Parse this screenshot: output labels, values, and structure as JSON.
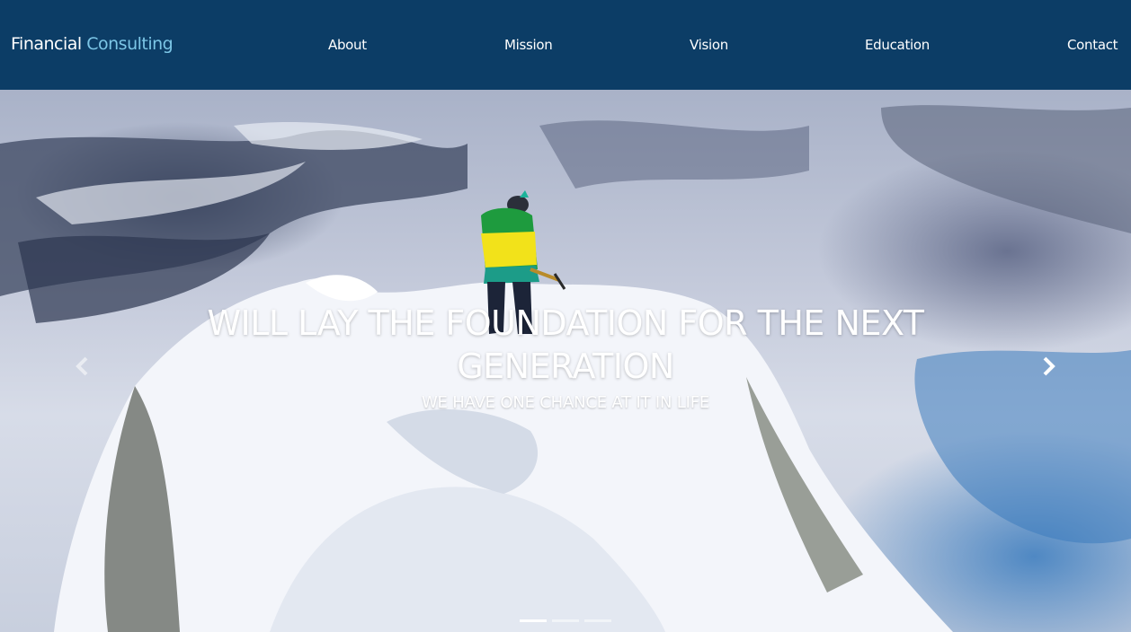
{
  "brand": {
    "name_primary": "Financial",
    "name_accent": "Consulting"
  },
  "nav": {
    "items": [
      {
        "label": "About"
      },
      {
        "label": "Mission"
      },
      {
        "label": "Vision"
      },
      {
        "label": "Education"
      },
      {
        "label": "Contact"
      }
    ]
  },
  "carousel": {
    "headline": "WILL LAY THE FOUNDATION FOR THE NEXT GENERATION",
    "subheadline": "WE HAVE ONE CHANCE AT IT IN LIFE",
    "active_slide": 1,
    "slide_count": 3
  },
  "colors": {
    "navbar_bg": "#0c3d66",
    "brand_accent": "#7cc6e6",
    "text": "#ffffff"
  },
  "icons": {
    "prev": "chevron-left-icon",
    "next": "chevron-right-icon"
  }
}
